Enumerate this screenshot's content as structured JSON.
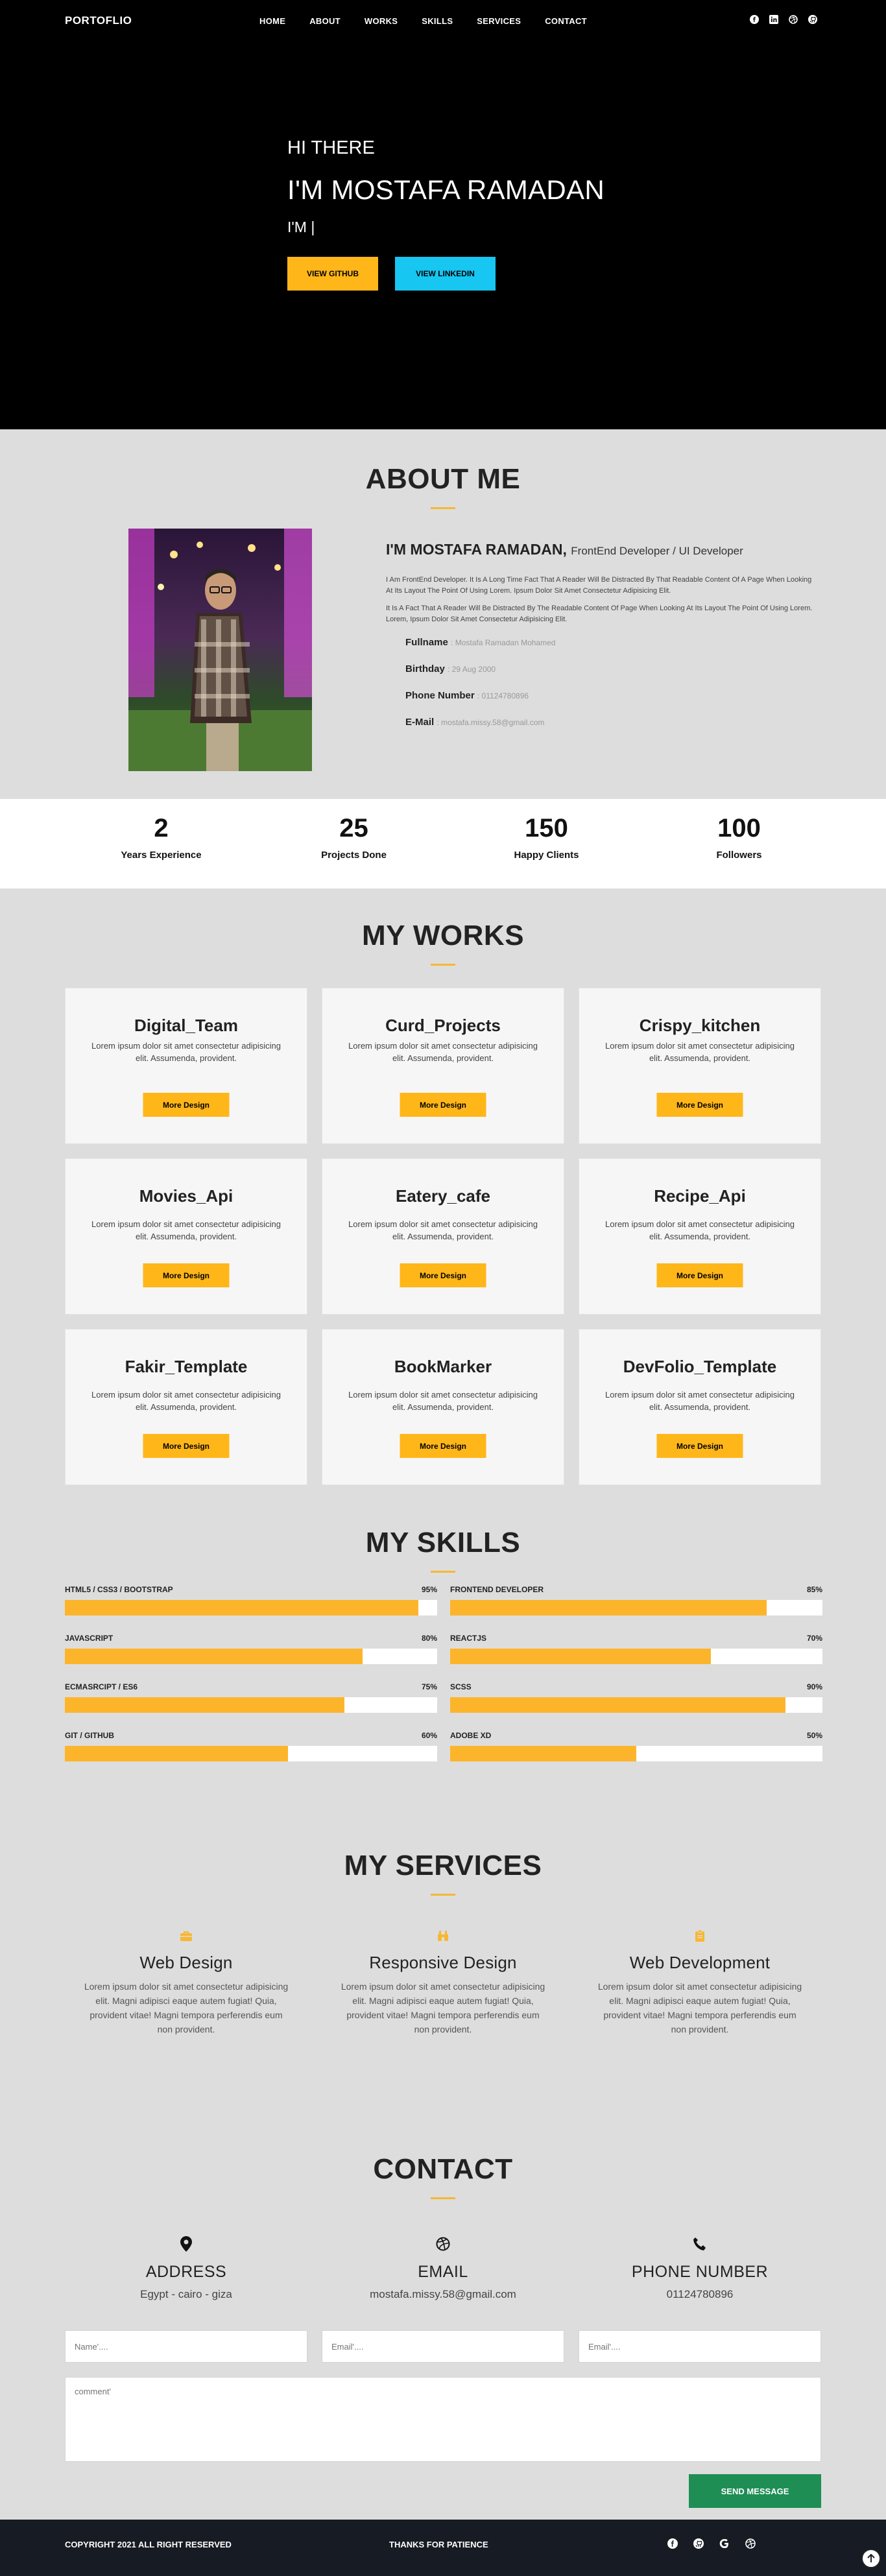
{
  "nav": {
    "brand": "PORTOFLIO",
    "links": [
      "HOME",
      "ABOUT",
      "WORKS",
      "SKILLS",
      "SERVICES",
      "CONTACT"
    ],
    "social_icons": [
      "facebook-icon",
      "linkedin-icon",
      "dribbble-icon",
      "github-icon"
    ]
  },
  "hero": {
    "greeting": "HI THERE",
    "name": "I'M MOSTAFA RAMADAN",
    "role": "I'M |",
    "github_button": "VIEW GITHUB",
    "linkedin_button": "VIEW LINKEDIN"
  },
  "about": {
    "title": "ABOUT ME",
    "name": "I'M MOSTAFA RAMADAN,",
    "subtitle": "FrontEnd Developer / UI Developer",
    "p1": "I Am FrontEnd Developer. It Is A Long Time Fact That A Reader Will Be Distracted By That Readable Content Of A Page When Looking At Its Layout The Point Of Using Lorem. Ipsum Dolor Sit Amet Consectetur Adipisicing Elit.",
    "p2": "It Is A Fact That A Reader Will Be Distracted By The Readable Content Of Page When Looking At Its Layout The Point Of Using Lorem. Lorem, Ipsum Dolor Sit Amet Consectetur Adipisicing Elit.",
    "facts": [
      {
        "label": "Fullname",
        "value": ": Mostafa Ramadan Mohamed"
      },
      {
        "label": "Birthday",
        "value": ": 29 Aug 2000"
      },
      {
        "label": "Phone Number",
        "value": ": 01124780896"
      },
      {
        "label": "E-Mail",
        "value": ": mostafa.missy.58@gmail.com"
      }
    ]
  },
  "stats": [
    {
      "num": "2",
      "label": "Years Experience"
    },
    {
      "num": "25",
      "label": "Projects Done"
    },
    {
      "num": "150",
      "label": "Happy Clients"
    },
    {
      "num": "100",
      "label": "Followers"
    }
  ],
  "works": {
    "title": "MY WORKS",
    "button": "More Design",
    "desc": "Lorem ipsum dolor sit amet consectetur adipisicing elit. Assumenda, provident.",
    "cards": [
      "Digital_Team",
      "Curd_Projects",
      "Crispy_kitchen",
      "Movies_Api",
      "Eatery_cafe",
      "Recipe_Api",
      "Fakir_Template",
      "BookMarker",
      "DevFolio_Template"
    ]
  },
  "skills": {
    "title": "MY SKILLS",
    "left": [
      {
        "name": "HTML5 / CSS3 / BOOTSTRAP",
        "pct": "95%",
        "value": 95
      },
      {
        "name": "JAVASCRIPT",
        "pct": "80%",
        "value": 80
      },
      {
        "name": "ECMASRCIPT / ES6",
        "pct": "75%",
        "value": 75
      },
      {
        "name": "GIT / GITHUB",
        "pct": "60%",
        "value": 60
      }
    ],
    "right": [
      {
        "name": "FRONTEND DEVELOPER",
        "pct": "85%",
        "value": 85
      },
      {
        "name": "REACTJS",
        "pct": "70%",
        "value": 70
      },
      {
        "name": "SCSS",
        "pct": "90%",
        "value": 90
      },
      {
        "name": "ADOBE XD",
        "pct": "50%",
        "value": 50
      }
    ]
  },
  "services": {
    "title": "MY SERVICES",
    "items": [
      {
        "title": "Web Design",
        "icon": "briefcase-icon",
        "desc": "Lorem ipsum dolor sit amet consectetur adipisicing elit. Magni adipisci eaque autem fugiat! Quia, provident vitae! Magni tempora perferendis eum non provident."
      },
      {
        "title": "Responsive Design",
        "icon": "binoculars-icon",
        "desc": "Lorem ipsum dolor sit amet consectetur adipisicing elit. Magni adipisci eaque autem fugiat! Quia, provident vitae! Magni tempora perferendis eum non provident."
      },
      {
        "title": "Web Development",
        "icon": "clipboard-icon",
        "desc": "Lorem ipsum dolor sit amet consectetur adipisicing elit. Magni adipisci eaque autem fugiat! Quia, provident vitae! Magni tempora perferendis eum non provident."
      }
    ]
  },
  "contact": {
    "title": "CONTACT",
    "items": [
      {
        "title": "ADDRESS",
        "value": "Egypt - cairo - giza"
      },
      {
        "title": "EMAIL",
        "value": "mostafa.missy.58@gmail.com"
      },
      {
        "title": "PHONE NUMBER",
        "value": "01124780896"
      }
    ],
    "name_placeholder": "Name'....",
    "email_placeholder": "Email'....",
    "email2_placeholder": "Email'....",
    "comment_placeholder": "comment'",
    "send": "SEND MESSAGE"
  },
  "footer": {
    "copyright": "COPYRIGHT 2021 ALL RIGHT RESERVED",
    "thanks": "THANKS FOR PATIENCE"
  },
  "colors": {
    "accent": "#ffb619",
    "linkedin": "#17c6f1",
    "send": "#1e8e55",
    "footer": "#171b23"
  }
}
